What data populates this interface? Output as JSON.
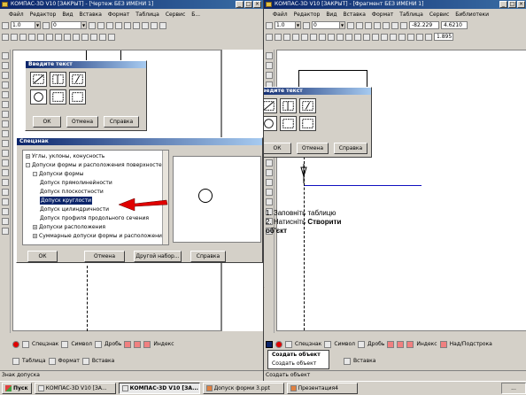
{
  "left": {
    "title": "КОМПАС-3D V10 [ЗАКРЫТ] - [Чертеж БЕЗ ИМЕНИ 1]",
    "menu": [
      "Файл",
      "Редактор",
      "Вид",
      "Вставка",
      "Формат",
      "Таблица",
      "Сервис",
      "Б..."
    ],
    "toolbar_combo1": "1.0",
    "toolbar_combo2": "0",
    "dialog_title": "Введите текст",
    "dialog_buttons": {
      "ok": "ОК",
      "cancel": "Отмена",
      "help": "Справка"
    },
    "specznak": {
      "title": "Спецзнак",
      "tree": [
        {
          "label": "Углы, уклоны, конусность",
          "level": 0,
          "box": "+"
        },
        {
          "label": "Допуски формы и расположения поверхностей",
          "level": 0,
          "box": "-"
        },
        {
          "label": "Допуски формы",
          "level": 1,
          "box": "-"
        },
        {
          "label": "Допуск прямолинейности",
          "level": 2,
          "box": ""
        },
        {
          "label": "Допуск плоскостности",
          "level": 2,
          "box": ""
        },
        {
          "label": "Допуск круглости",
          "level": 2,
          "box": "",
          "selected": true
        },
        {
          "label": "Допуск цилиндричности",
          "level": 2,
          "box": ""
        },
        {
          "label": "Допуск профиля продольного сечения",
          "level": 2,
          "box": ""
        },
        {
          "label": "Допуски расположения",
          "level": 1,
          "box": "+"
        },
        {
          "label": "Суммарные допуски формы и расположения",
          "level": 1,
          "box": "+"
        }
      ],
      "buttons": {
        "ok": "ОК",
        "cancel": "Отмена",
        "other": "Другой набор...",
        "help": "Справка"
      }
    },
    "bottom": {
      "special": "Спецзнак",
      "symbol": "Символ",
      "fraction": "Дробь",
      "index": "Индекс"
    },
    "bottom2": {
      "table": "Таблица",
      "format": "Формат",
      "insert": "Вставка"
    },
    "status": "Знак допуска"
  },
  "right": {
    "title": "КОМПАС-3D V10 [ЗАКРЫТ] - [Фрагмент БЕЗ ИМЕНИ 1]",
    "menu": [
      "Файл",
      "Редактор",
      "Вид",
      "Вставка",
      "Формат",
      "Таблица",
      "Сервис",
      "Библиотеки"
    ],
    "toolbar_combo1": "1.0",
    "toolbar_combo2": "0",
    "coord_x": "-82.229",
    "coord_y": "4.6210",
    "zoom": "1.895",
    "dialog_title": "Введите текст",
    "dialog_buttons": {
      "ok": "ОК",
      "cancel": "Отмена",
      "help": "Справка"
    },
    "instructions": {
      "line1": "1. Заповніть таблицю",
      "line2a": "2. Натисніть ",
      "line2b": "Створити",
      "line3": "об'єкт"
    },
    "bottom": {
      "special": "Спецзнак",
      "symbol": "Символ",
      "fraction": "Дробь",
      "index": "Индекс",
      "over": "Над/Подстрока"
    },
    "bottom2": {
      "insert": "Вставка"
    },
    "ctxmenu": [
      "Создать объект",
      "Создать объект"
    ],
    "status": "Создать объект"
  },
  "taskbar": {
    "start": "Пуск",
    "tasks": [
      "КОМПАС-3D V10 [ЗА...",
      "КОМПАС-3D V10 [ЗА...",
      "Допуск форми 3.ppt",
      "Презентация4"
    ],
    "clock": "..."
  },
  "colors": {
    "title_blue": "#0a246a",
    "arrow_red": "#e00000",
    "line_blue": "#1010c0"
  }
}
